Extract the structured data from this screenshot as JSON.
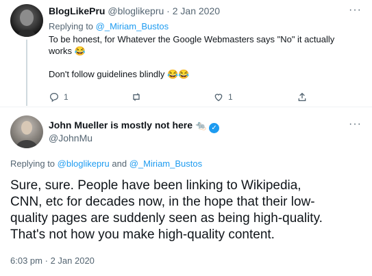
{
  "tweet1": {
    "display_name": "BlogLikePru",
    "handle": "@bloglikepru",
    "sep": "·",
    "date": "2 Jan 2020",
    "replying_prefix": "Replying to",
    "replying_to": "@_Miriam_Bustos",
    "text_line1": "To be honest, for Whatever the Google Webmasters says \"No\" it actually",
    "text_line2": "works",
    "emoji_laugh": "😂",
    "text_line3": "Don't follow guidelines blindly",
    "emoji_laugh_double": "😂😂",
    "reply_count": "1",
    "retweet_count": "",
    "like_count": "1"
  },
  "tweet2": {
    "display_name": "John Mueller is mostly not here",
    "emoji_rat": "🐀",
    "verified_glyph": "✓",
    "handle": "@JohnMu",
    "replying_prefix": "Replying to",
    "replying_to_1": "@bloglikepru",
    "replying_and": "and",
    "replying_to_2": "@_Miriam_Bustos",
    "body_line1": "Sure, sure. People have been linking to Wikipedia,",
    "body_line2": "CNN, etc for decades now, in the hope that their low-",
    "body_line3": "quality pages are suddenly seen as being high-quality.",
    "body_line4": "That's not how you make high-quality content.",
    "time": "6:03 pm",
    "sep": "·",
    "date": "2 Jan 2020"
  },
  "more_glyph": "···",
  "colors": {
    "accent": "#1d9bf0",
    "text": "#0f1419",
    "muted": "#536471",
    "line": "#cfd9de"
  }
}
